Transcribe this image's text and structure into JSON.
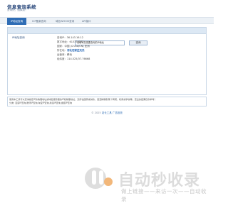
{
  "header": {
    "title": "信息查询系统",
    "subtitle": "查询快，结果准！"
  },
  "nav": {
    "items": [
      {
        "label": "IP地址查询",
        "active": true
      },
      {
        "label": "ICP备案查询",
        "active": false
      },
      {
        "label": "域名WHOIS查询",
        "active": false
      },
      {
        "label": "API接口",
        "active": false
      }
    ]
  },
  "panel": {
    "title": "IP地址查询",
    "search": {
      "value": "请填写您需要查询的IP地址",
      "button_label": "查询"
    }
  },
  "result": {
    "rows": [
      {
        "k": "查询IP：",
        "v": "36.143.16.12",
        "blue": false
      },
      {
        "k": "数字地址：",
        "v": "613355532",
        "blue": false
      },
      {
        "k": "国家：",
        "v": "中国 (China/CN) 亚洲",
        "blue": false
      },
      {
        "k": "所在地：",
        "v": "河北石家庄元氏",
        "blue": true
      },
      {
        "k": "运营商：",
        "v": "移动",
        "blue": false
      },
      {
        "k": "经纬度：",
        "v": "114.525/37.76668",
        "blue": false
      }
    ]
  },
  "description": {
    "line1": "使用本工具可以查询指定IP的物理地址或域名服务器的IP和物理地址，及所在国家或城市，甚至精确到某个网吧，机房或学校等；查出的结果仅供参考！",
    "line2": "分类: 百度IP查询,腾讯IP查询,淘宝IP查询,新浪IP查询,搜狐IP查询"
  },
  "footer": {
    "copyright": "© 2025",
    "links": [
      "站长工具",
      "广告投放"
    ]
  },
  "watermark": {
    "text": "自动秒收录",
    "sub": "做上链接——来访一次——自动收录"
  }
}
